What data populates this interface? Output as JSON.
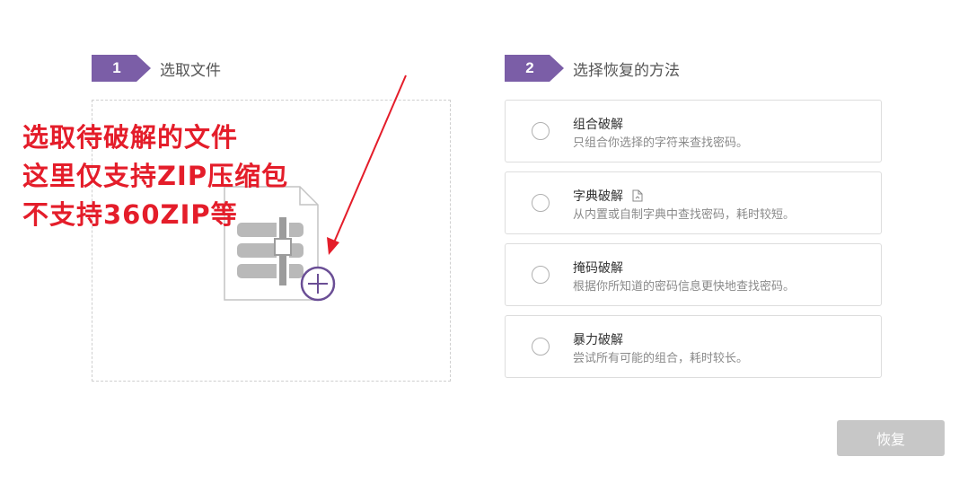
{
  "steps": [
    {
      "number": "1",
      "title": "选取文件"
    },
    {
      "number": "2",
      "title": "选择恢复的方法"
    }
  ],
  "annotation": {
    "lines": [
      "选取待破解的文件",
      "这里仅支持ZIP压缩包",
      "不支持360ZIP等"
    ],
    "color": "#e41d2a"
  },
  "methods": [
    {
      "name": "组合破解",
      "desc": "只组合你选择的字符来查找密码。",
      "icon": null
    },
    {
      "name": "字典破解",
      "desc": "从内置或自制字典中查找密码，耗时较短。",
      "icon": "document-icon"
    },
    {
      "name": "掩码破解",
      "desc": "根据你所知道的密码信息更快地查找密码。",
      "icon": null
    },
    {
      "name": "暴力破解",
      "desc": "尝试所有可能的组合，耗时较长。",
      "icon": null
    }
  ],
  "recover_button": {
    "label": "恢复"
  },
  "colors": {
    "accent": "#7b5ea7",
    "button_disabled": "#c7c7c7",
    "annotation": "#e41d2a"
  }
}
